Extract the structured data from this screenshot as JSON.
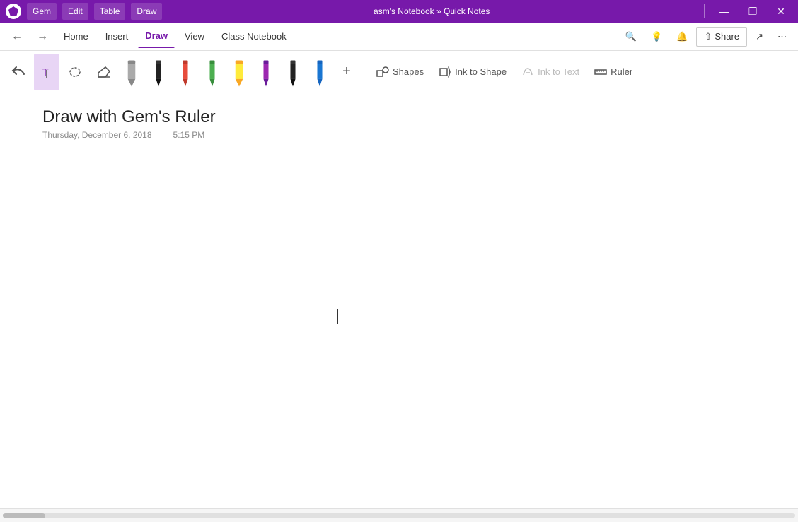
{
  "titlebar": {
    "title": "asm's Notebook » Quick Notes",
    "gem_label": "Gem",
    "edit_label": "Edit",
    "table_label": "Table",
    "draw_label": "Draw",
    "minimize": "—",
    "restore": "❐",
    "close": "✕"
  },
  "menubar": {
    "back_label": "←",
    "forward_label": "→",
    "tabs": [
      "Home",
      "Insert",
      "Draw",
      "View",
      "Class Notebook"
    ],
    "active_tab": "Draw",
    "search_icon": "🔍",
    "lightbulb_icon": "💡",
    "bell_icon": "🔔",
    "share_label": "Share",
    "expand_icon": "⤢",
    "more_icon": "···"
  },
  "ribbon": {
    "undo_label": "↩",
    "select_label": "T",
    "lasso_label": "⊙",
    "eraser_label": "✦",
    "shapes_label": "Shapes",
    "ink_to_shape_label": "Ink to Shape",
    "ink_to_text_label": "Ink to Text",
    "ruler_label": "Ruler",
    "add_pen_label": "+",
    "pens": [
      {
        "color": "#888",
        "type": "highlighter",
        "width": "thick"
      },
      {
        "color": "#000",
        "type": "pen",
        "width": "medium"
      },
      {
        "color": "#e03030",
        "type": "pen",
        "width": "medium"
      },
      {
        "color": "#4caf50",
        "type": "pen",
        "width": "medium"
      },
      {
        "color": "#ffeb3b",
        "type": "highlighter",
        "width": "thick"
      },
      {
        "color": "#9c27b0",
        "type": "pen",
        "width": "medium"
      },
      {
        "color": "#000",
        "type": "pen",
        "width": "medium"
      },
      {
        "color": "#1565c0",
        "type": "pen",
        "width": "medium"
      }
    ]
  },
  "page": {
    "title": "Draw with Gem's Ruler",
    "date": "Thursday, December 6, 2018",
    "time": "5:15 PM"
  }
}
